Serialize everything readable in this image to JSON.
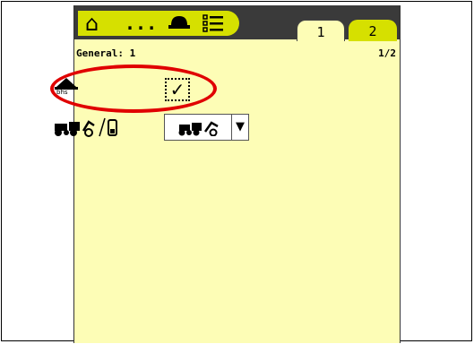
{
  "topbar": {
    "home_icon": "home-icon",
    "ellipsis": "...",
    "helmet_icon": "operator-icon",
    "list_icon": "menu-list-icon"
  },
  "tabs": [
    {
      "label": "1",
      "active": true
    },
    {
      "label": "2",
      "active": false
    }
  ],
  "header": {
    "title": "General: 1",
    "page_indicator": "1/2"
  },
  "rows": {
    "bhs": {
      "label": "bhs",
      "icon": "spreader-bhs-icon",
      "checked": true,
      "check_glyph": "✓"
    },
    "machine": {
      "icon": "tractor-loader-icon",
      "selected_icon": "tractor-loader-icon",
      "arrow": "▼"
    }
  },
  "colors": {
    "background": "#fdfdb6",
    "accent": "#d6e000",
    "topbar": "#3a3a3a",
    "highlight": "#e00000"
  }
}
